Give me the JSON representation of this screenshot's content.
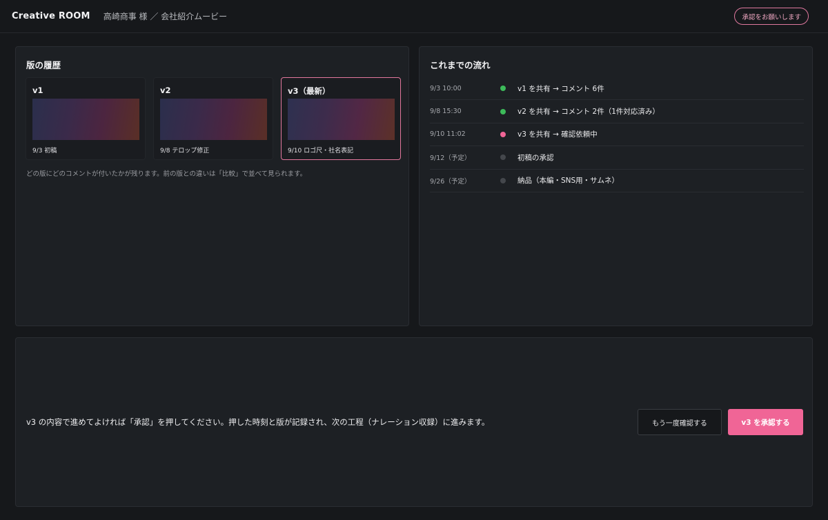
{
  "header": {
    "brand": "Creative ROOM",
    "breadcrumb": "高崎商事 様 ／ 会社紹介ムービー",
    "request_label": "承認をお願いします"
  },
  "history": {
    "title": "版の履歴",
    "versions": [
      {
        "label": "v1",
        "caption": "9/3 初稿",
        "active": false
      },
      {
        "label": "v2",
        "caption": "9/8 テロップ修正",
        "active": false
      },
      {
        "label": "v3（最新）",
        "caption": "9/10 ロゴ尺・社名表記",
        "active": true
      }
    ],
    "note": "どの版にどのコメントが付いたかが残ります。前の版との違いは「比較」で並べて見られます。"
  },
  "flow": {
    "title": "これまでの流れ",
    "events": [
      {
        "date": "9/3 10:00",
        "text": "v1 を共有 → コメント 6件",
        "status": "done",
        "color": "#3dbb5a"
      },
      {
        "date": "9/8 15:30",
        "text": "v2 を共有 → コメント 2件（1件対応済み）",
        "status": "done",
        "color": "#3dbb5a"
      },
      {
        "date": "9/10 11:02",
        "text": "v3 を共有 → 確認依頼中",
        "status": "current",
        "color": "#f06596"
      },
      {
        "date": "9/12（予定）",
        "text": "初稿の承認",
        "status": "pending",
        "color": "#44474c"
      },
      {
        "date": "9/26（予定）",
        "text": "納品（本編・SNS用・サムネ）",
        "status": "pending",
        "color": "#44474c"
      }
    ]
  },
  "approve": {
    "message": "v3 の内容で進めてよければ「承認」を押してください。押した時刻と版が記録され、次の工程（ナレーション収録）に進みます。",
    "recheck_label": "もう一度確認する",
    "approve_label": "v3 を承認する"
  },
  "colors": {
    "accent": "#f06596",
    "done": "#3dbb5a",
    "pending": "#44474c",
    "background": "#16181b",
    "panel": "#1d2024"
  }
}
